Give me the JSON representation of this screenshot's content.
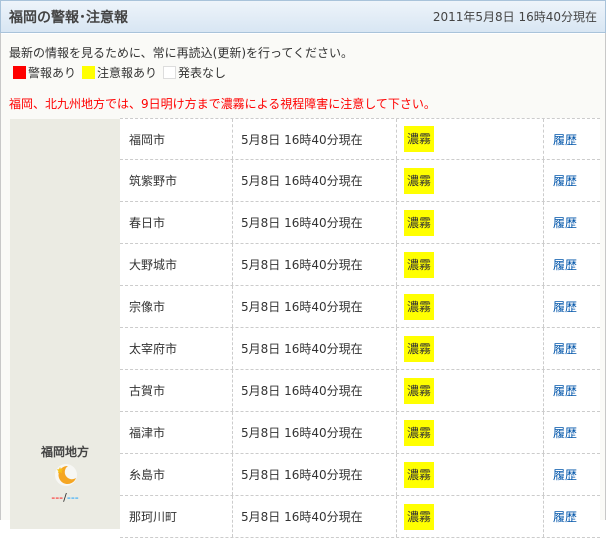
{
  "header": {
    "title": "福岡の警報･注意報",
    "timestamp": "2011年5月8日 16時40分現在"
  },
  "notice": "最新の情報を見るために、常に再読込(更新)を行ってください。",
  "legend": [
    {
      "label": "警報あり",
      "color": "#ff0000"
    },
    {
      "label": "注意報あり",
      "color": "#ffff00"
    },
    {
      "label": "発表なし",
      "color": "#ffffff"
    }
  ],
  "alert": "福岡、北九州地方では、9日明け方まで濃霧による視程障害に注意して下さい。",
  "region": {
    "name": "福岡地方",
    "temp_high": "---",
    "sep": "/",
    "temp_low": "---",
    "weather_icon": "moon-icon"
  },
  "rows": [
    {
      "city": "福岡市",
      "time": "5月8日 16時40分現在",
      "warning": "濃霧",
      "link": "履歴"
    },
    {
      "city": "筑紫野市",
      "time": "5月8日 16時40分現在",
      "warning": "濃霧",
      "link": "履歴"
    },
    {
      "city": "春日市",
      "time": "5月8日 16時40分現在",
      "warning": "濃霧",
      "link": "履歴"
    },
    {
      "city": "大野城市",
      "time": "5月8日 16時40分現在",
      "warning": "濃霧",
      "link": "履歴"
    },
    {
      "city": "宗像市",
      "time": "5月8日 16時40分現在",
      "warning": "濃霧",
      "link": "履歴"
    },
    {
      "city": "太宰府市",
      "time": "5月8日 16時40分現在",
      "warning": "濃霧",
      "link": "履歴"
    },
    {
      "city": "古賀市",
      "time": "5月8日 16時40分現在",
      "warning": "濃霧",
      "link": "履歴"
    },
    {
      "city": "福津市",
      "time": "5月8日 16時40分現在",
      "warning": "濃霧",
      "link": "履歴"
    },
    {
      "city": "糸島市",
      "time": "5月8日 16時40分現在",
      "warning": "濃霧",
      "link": "履歴"
    },
    {
      "city": "那珂川町",
      "time": "5月8日 16時40分現在",
      "warning": "濃霧",
      "link": "履歴"
    }
  ]
}
